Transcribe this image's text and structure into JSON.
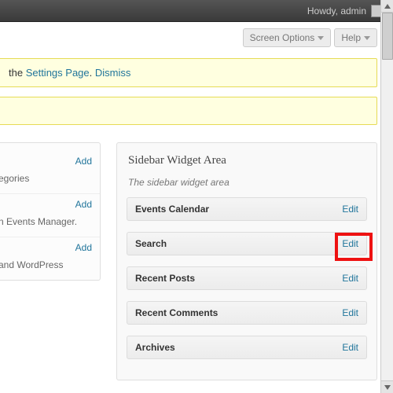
{
  "topbar": {
    "howdy": "Howdy, admin"
  },
  "screen": {
    "options": "Screen Options",
    "help": "Help"
  },
  "notice": {
    "prefix": "the ",
    "link1": "Settings Page",
    "sep": ". ",
    "link2": "Dismiss"
  },
  "left": {
    "items": [
      {
        "add": "Add",
        "desc": "egories"
      },
      {
        "add": "Add",
        "desc": "n Events Manager."
      },
      {
        "add": "Add",
        "desc": "and WordPress"
      }
    ]
  },
  "area": {
    "title": "Sidebar Widget Area",
    "desc": "The sidebar widget area",
    "widgets": [
      {
        "name": "Events Calendar",
        "edit": "Edit"
      },
      {
        "name": "Search",
        "edit": "Edit"
      },
      {
        "name": "Recent Posts",
        "edit": "Edit"
      },
      {
        "name": "Recent Comments",
        "edit": "Edit"
      },
      {
        "name": "Archives",
        "edit": "Edit"
      }
    ]
  }
}
